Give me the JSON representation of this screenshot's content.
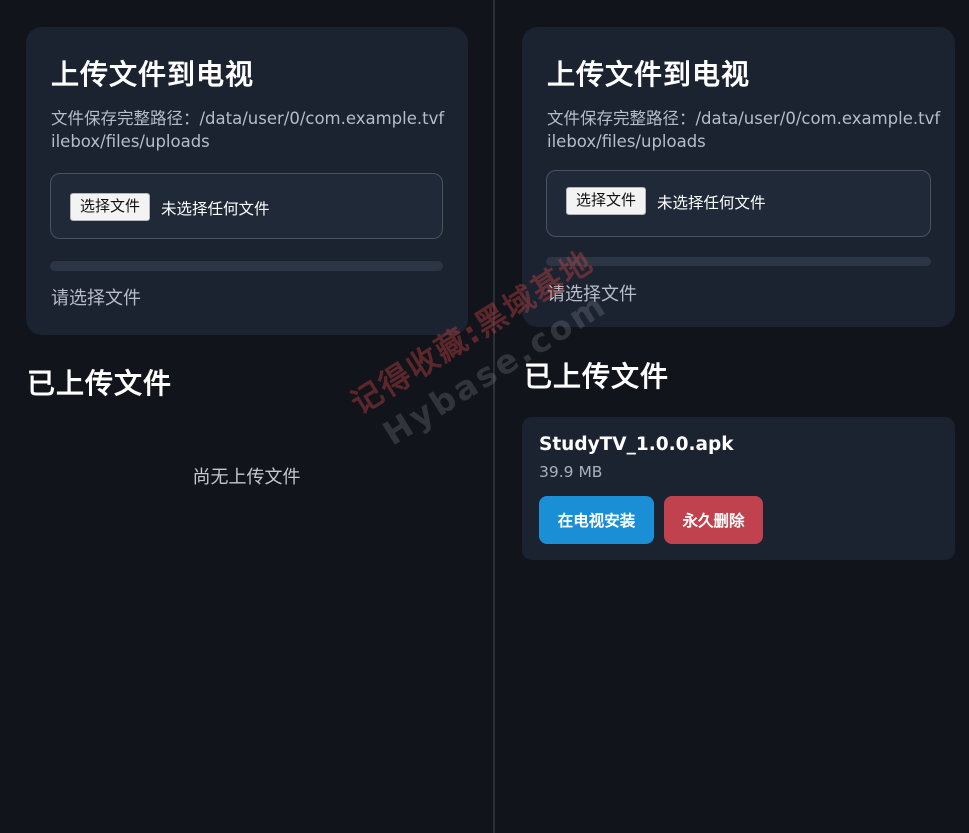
{
  "left": {
    "upload": {
      "title": "上传文件到电视",
      "path": "文件保存完整路径：/data/user/0/com.example.tvfilebox/files/uploads",
      "choose_button": "选择文件",
      "no_file": "未选择任何文件",
      "progress": 0,
      "status": "请选择文件"
    },
    "uploaded_title": "已上传文件",
    "empty_message": "尚无上传文件"
  },
  "right": {
    "upload": {
      "title": "上传文件到电视",
      "path": "文件保存完整路径：/data/user/0/com.example.tvfilebox/files/uploads",
      "choose_button": "选择文件",
      "no_file": "未选择任何文件",
      "progress": 0,
      "status": "请选择文件"
    },
    "uploaded_title": "已上传文件",
    "files": [
      {
        "name": "StudyTV_1.0.0.apk",
        "size": "39.9 MB",
        "install_label": "在电视安装",
        "delete_label": "永久删除"
      }
    ]
  },
  "watermark": {
    "line1": "记得收藏:黑域基地",
    "line2": "Hybase.com"
  },
  "colors": {
    "background": "#11141b",
    "card": "#1b2230",
    "install": "#1a8fd6",
    "delete": "#c0424e"
  }
}
